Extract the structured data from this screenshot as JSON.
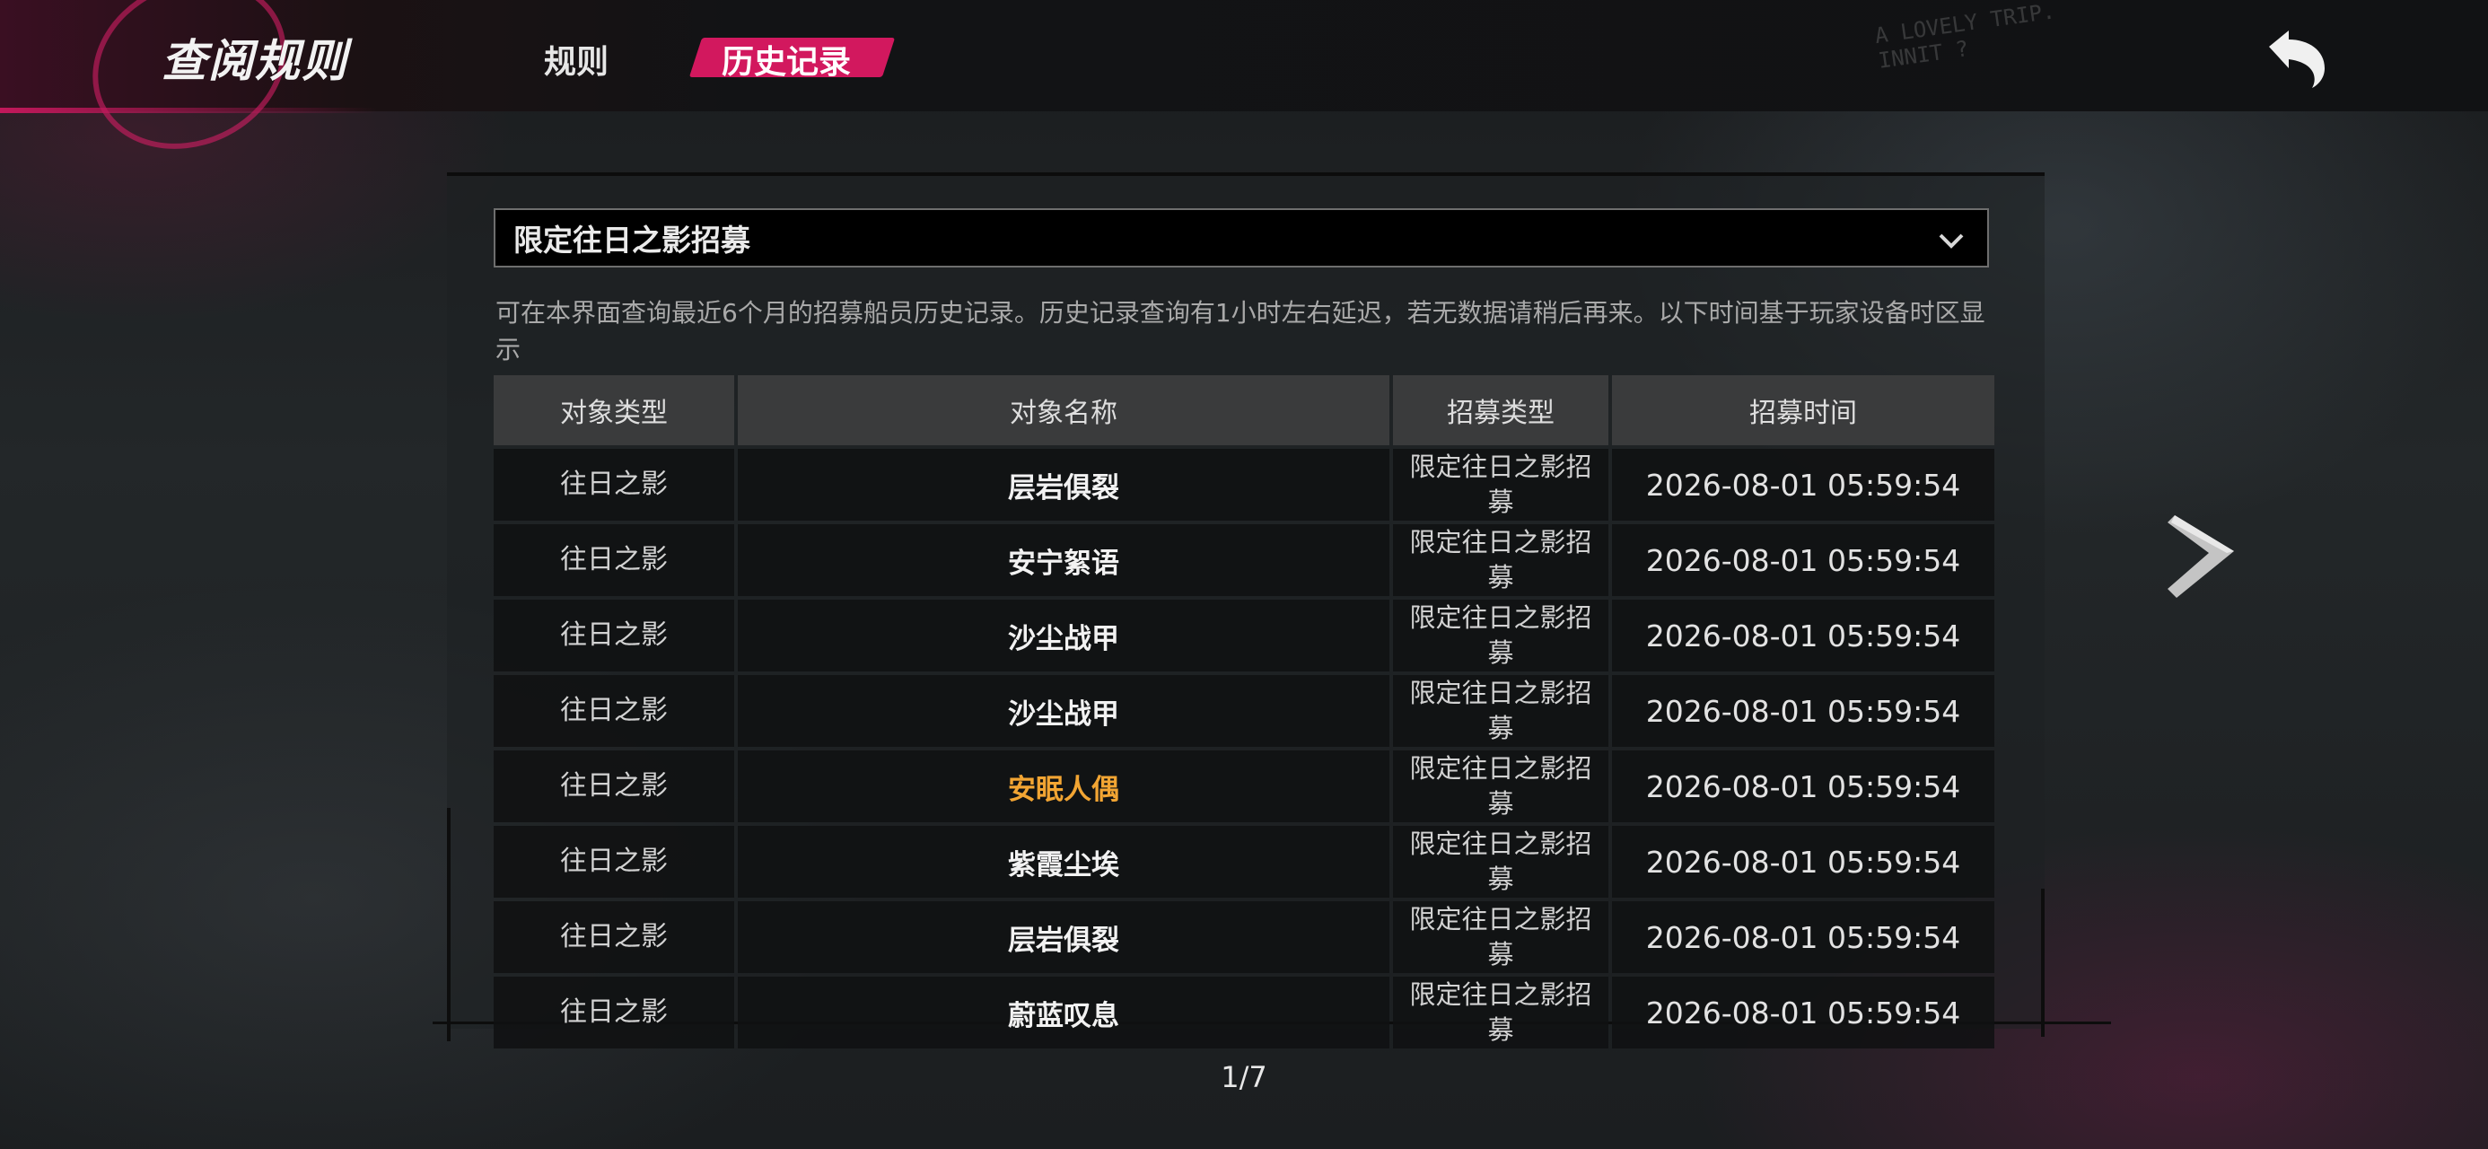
{
  "header": {
    "title": "查阅规则",
    "tabs": [
      {
        "label": "规则",
        "active": false
      },
      {
        "label": "历史记录",
        "active": true
      }
    ],
    "accent_color": "#d2185e",
    "back_icon": "back-arrow-icon",
    "corner_decor_text": [
      "A LOVELY TRIP.",
      "INNIT ?"
    ]
  },
  "dropdown": {
    "selected": "限定往日之影招募",
    "icon": "chevron-down-icon"
  },
  "info_text": "可在本界面查询最近6个月的招募船员历史记录。历史记录查询有1小时左右延迟，若无数据请稍后再来。以下时间基于玩家设备时区显示",
  "table": {
    "columns": [
      "对象类型",
      "对象名称",
      "招募类型",
      "招募时间"
    ],
    "rows": [
      {
        "type": "往日之影",
        "name": "层岩俱裂",
        "recruit": "限定往日之影招募",
        "time": "2026-08-01 05:59:54",
        "highlight": false
      },
      {
        "type": "往日之影",
        "name": "安宁絮语",
        "recruit": "限定往日之影招募",
        "time": "2026-08-01 05:59:54",
        "highlight": false
      },
      {
        "type": "往日之影",
        "name": "沙尘战甲",
        "recruit": "限定往日之影招募",
        "time": "2026-08-01 05:59:54",
        "highlight": false
      },
      {
        "type": "往日之影",
        "name": "沙尘战甲",
        "recruit": "限定往日之影招募",
        "time": "2026-08-01 05:59:54",
        "highlight": false
      },
      {
        "type": "往日之影",
        "name": "安眠人偶",
        "recruit": "限定往日之影招募",
        "time": "2026-08-01 05:59:54",
        "highlight": true
      },
      {
        "type": "往日之影",
        "name": "紫霞尘埃",
        "recruit": "限定往日之影招募",
        "time": "2026-08-01 05:59:54",
        "highlight": false
      },
      {
        "type": "往日之影",
        "name": "层岩俱裂",
        "recruit": "限定往日之影招募",
        "time": "2026-08-01 05:59:54",
        "highlight": false
      },
      {
        "type": "往日之影",
        "name": "蔚蓝叹息",
        "recruit": "限定往日之影招募",
        "time": "2026-08-01 05:59:54",
        "highlight": false
      }
    ],
    "highlight_color": "#f2a533"
  },
  "pagination": {
    "label": "1/7",
    "current": 1,
    "total": 7,
    "next_icon": "chevron-right-icon"
  }
}
